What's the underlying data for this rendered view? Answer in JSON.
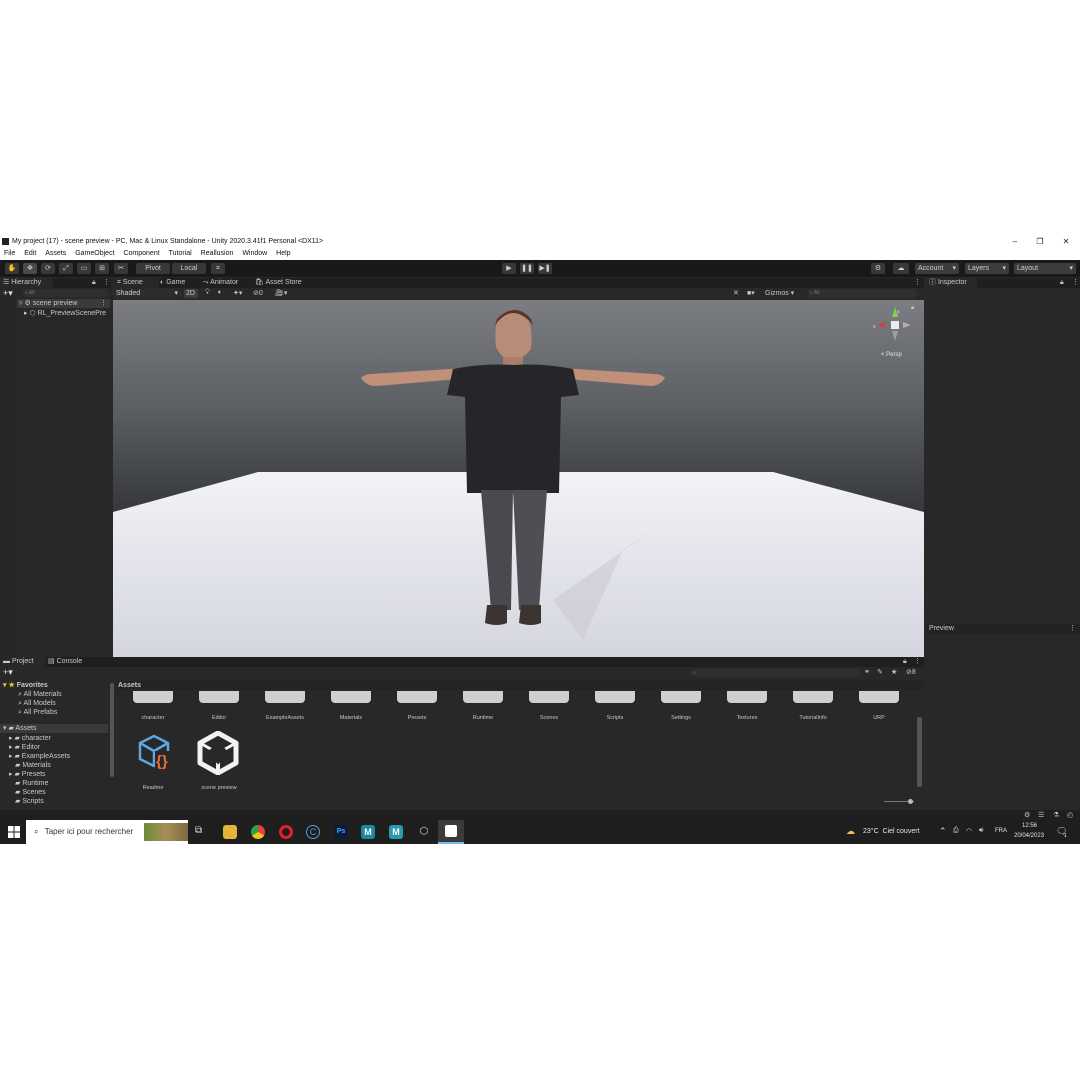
{
  "window": {
    "title": "My project (17) - scene preview - PC, Mac & Linux Standalone - Unity 2020.3.41f1 Personal <DX11>",
    "controls": [
      "–",
      "❐",
      "✕"
    ]
  },
  "menu": [
    "File",
    "Edit",
    "Assets",
    "GameObject",
    "Component",
    "Tutorial",
    "Reallusion",
    "Window",
    "Help"
  ],
  "toolbar": {
    "pivot": "Pivot",
    "local": "Local",
    "account": "Account",
    "layers": "Layers",
    "layout": "Layout"
  },
  "hierarchy": {
    "tab": "Hierarchy",
    "search_placeholder": "All",
    "scene": "scene preview",
    "child": "RL_PreviewScenePre"
  },
  "scene_tabs": [
    "Scene",
    "Game",
    "Animator",
    "Asset Store"
  ],
  "scene_toolbar": {
    "shading": "Shaded",
    "mode2d": "2D",
    "gizmos": "Gizmos",
    "search_placeholder": "All",
    "persp": "< Persp",
    "layer_count": "0"
  },
  "inspector": {
    "tab": "Inspector",
    "preview": "Preview"
  },
  "project": {
    "tabs": [
      "Project",
      "Console"
    ],
    "favorites_label": "Favorites",
    "favorites": [
      "All Materials",
      "All Models",
      "All Prefabs"
    ],
    "assets_label": "Assets",
    "tree": [
      "character",
      "Editor",
      "ExampleAssets",
      "Materials",
      "Presets",
      "Runtime",
      "Scenes",
      "Scripts"
    ],
    "breadcrumb": "Assets",
    "folders": [
      "character",
      "Editor",
      "ExampleAssets",
      "Materials",
      "Presets",
      "Runtime",
      "Scenes",
      "Scripts",
      "Settings",
      "Textures",
      "TutorialInfo",
      "URP"
    ],
    "files": [
      "Readme",
      "scene preview"
    ],
    "count_badge": "8"
  },
  "taskbar": {
    "search_placeholder": "Taper ici pour rechercher",
    "weather": "23°C  Ciel couvert",
    "lang": "FRA",
    "time": "12:56",
    "date": "20/04/2023",
    "notif_count": "1",
    "app_labels": {
      "ps": "Ps",
      "m1": "M",
      "m2": "M",
      "c": "C"
    }
  }
}
